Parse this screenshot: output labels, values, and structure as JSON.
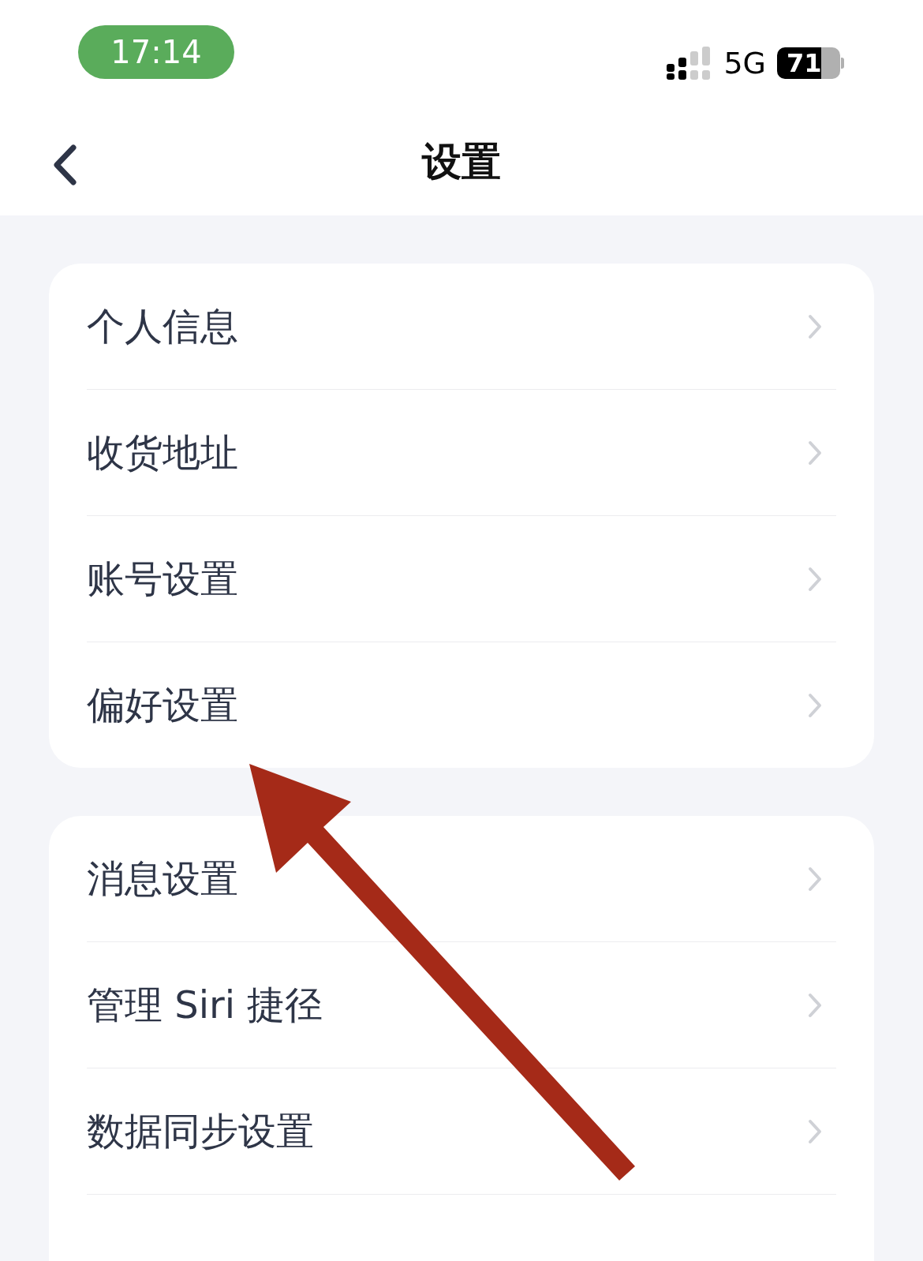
{
  "status_bar": {
    "time": "17:14",
    "network": "5G",
    "battery": "71"
  },
  "nav_bar": {
    "title": "设置"
  },
  "groups": [
    {
      "rows": [
        {
          "label": "个人信息"
        },
        {
          "label": "收货地址"
        },
        {
          "label": "账号设置"
        },
        {
          "label": "偏好设置"
        }
      ]
    },
    {
      "rows": [
        {
          "label": "消息设置"
        },
        {
          "label": "管理 Siri 捷径"
        },
        {
          "label": "数据同步设置"
        }
      ]
    }
  ]
}
